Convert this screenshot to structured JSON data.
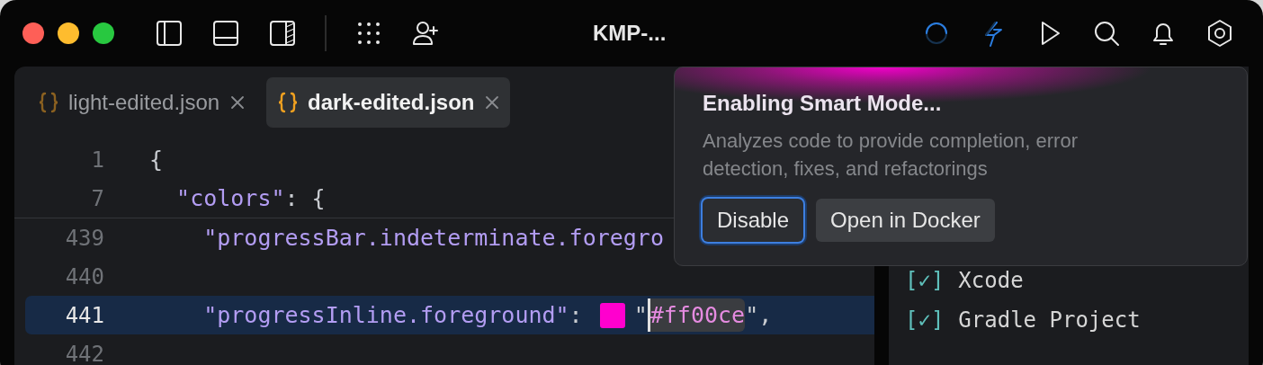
{
  "window": {
    "title": "KMP-..."
  },
  "tabs": [
    {
      "label": "light-edited.json",
      "selected": false
    },
    {
      "label": "dark-edited.json",
      "selected": true
    }
  ],
  "editor": {
    "sticky_lines": [
      {
        "number": "1",
        "selected": false,
        "tokens": [
          {
            "kind": "punct",
            "text": "{"
          }
        ]
      },
      {
        "number": "7",
        "selected": false,
        "tokens": [
          {
            "kind": "key",
            "text": "  \"colors\""
          },
          {
            "kind": "punct",
            "text": ": {"
          }
        ]
      }
    ],
    "lines": [
      {
        "number": "439",
        "selected": false,
        "tokens": [
          {
            "kind": "key",
            "text": "    \"progressBar.indeterminate.foregro"
          }
        ]
      },
      {
        "number": "440",
        "selected": false
      },
      {
        "number": "441",
        "selected": true,
        "tokens": [
          {
            "kind": "key",
            "text": "    \"progressInline.foreground\""
          },
          {
            "kind": "punct",
            "text": ": "
          },
          {
            "kind": "swatch",
            "color": "#ff00ce"
          },
          {
            "kind": "punct",
            "text": "\""
          },
          {
            "kind": "value",
            "text": "#ff00ce"
          },
          {
            "kind": "punct",
            "text": "\","
          }
        ]
      },
      {
        "number": "442",
        "selected": false
      }
    ]
  },
  "checklist": [
    {
      "box": "[✓]",
      "label": "Xcode",
      "checked": true
    },
    {
      "box": "[✓]",
      "label": "Gradle Project",
      "checked": true
    }
  ],
  "popup": {
    "title": "Enabling Smart Mode...",
    "description": "Analyzes code to provide completion, error detection, fixes, and refactorings",
    "buttons": [
      {
        "label": "Disable",
        "kind": "focused"
      },
      {
        "label": "Open in Docker",
        "kind": "normal"
      }
    ]
  }
}
